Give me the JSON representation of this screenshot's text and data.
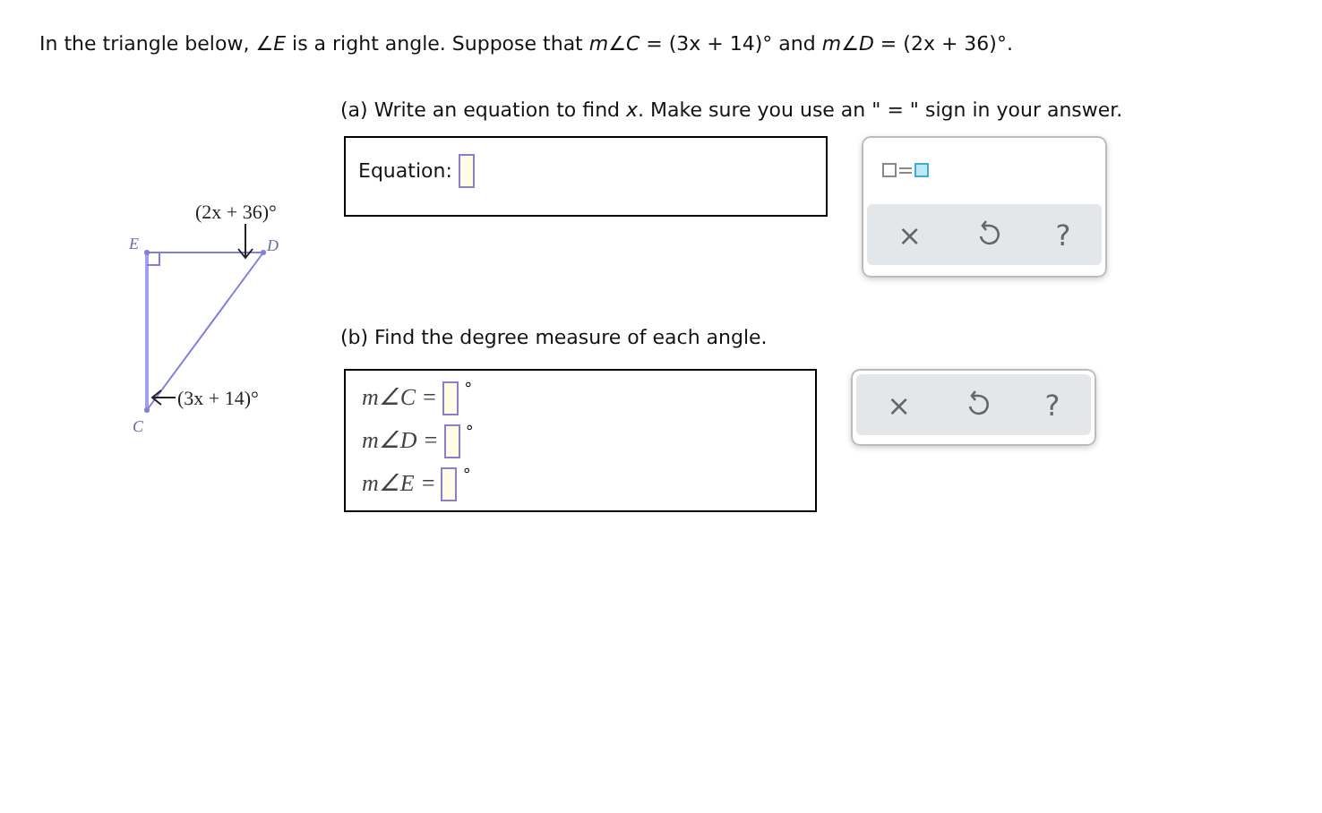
{
  "intro": "In the triangle below, ∠*E* is a right angle. Suppose that *m*∠*C* = (3x + 14)° and *m*∠*D* = (2x + 36)°.",
  "diagram": {
    "vertices": [
      {
        "label": "E"
      },
      {
        "label": "D"
      },
      {
        "label": "C"
      }
    ],
    "angle_labels": [
      "(2x + 36)°",
      "(3x + 14)°"
    ]
  },
  "part_a": {
    "prompt": "(a) Write an equation to find *x*. Make sure you use an \" = \" sign in your answer.",
    "field_label": "Equation:",
    "toolbar": [
      "×",
      "?"
    ]
  },
  "part_b": {
    "prompt": "(b) Find the degree measure of each angle.",
    "rows": [
      {
        "label": "m∠C =",
        "unit": "°"
      },
      {
        "label": "m∠D =",
        "unit": "°"
      },
      {
        "label": "m∠E =",
        "unit": "°"
      }
    ],
    "toolbar": [
      "×",
      "?"
    ]
  }
}
